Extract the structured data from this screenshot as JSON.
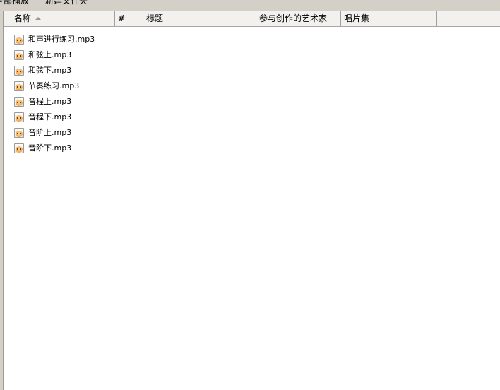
{
  "toolbar": {
    "play_all": "全部播放",
    "new_folder": "新建文件夹"
  },
  "columns": {
    "name": "名称",
    "number": "#",
    "title": "标题",
    "artists": "参与创作的艺术家",
    "album": "唱片集"
  },
  "sort": {
    "column": "name",
    "direction": "ascending"
  },
  "files": [
    "和声进行练习.mp3",
    "和弦上.mp3",
    "和弦下.mp3",
    "节奏练习.mp3",
    "音程上.mp3",
    "音程下.mp3",
    "音阶上.mp3",
    "音阶下.mp3"
  ],
  "icons": {
    "file": "audio-file-icon",
    "sort": "sort-ascending-icon"
  }
}
